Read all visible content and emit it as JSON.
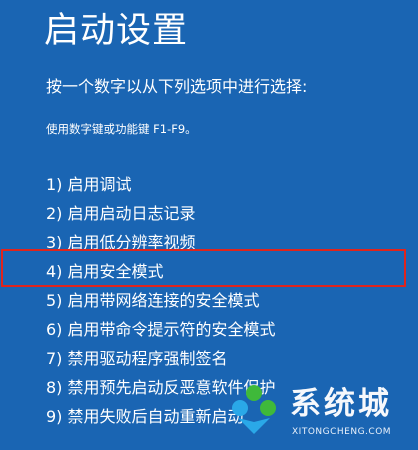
{
  "screen": {
    "title": "启动设置",
    "prompt": "按一个数字以从下列选项中进行选择:",
    "hint": "使用数字键或功能键 F1-F9。",
    "options": [
      {
        "label": "1) 启用调试"
      },
      {
        "label": "2) 启用启动日志记录"
      },
      {
        "label": "3) 启用低分辨率视频"
      },
      {
        "label": "4) 启用安全模式"
      },
      {
        "label": "5) 启用带网络连接的安全模式"
      },
      {
        "label": "6) 启用带命令提示符的安全模式"
      },
      {
        "label": "7) 禁用驱动程序强制签名"
      },
      {
        "label": "8) 禁用预先启动反恶意软件保护"
      },
      {
        "label": "9) 禁用失败后自动重新启动"
      }
    ],
    "highlighted_option_index": 3
  },
  "watermark": {
    "text": "系统城",
    "url_text": "XITONGCHENG.COM"
  },
  "colors": {
    "background": "#1a65b3",
    "text": "#ffffff",
    "highlight_border": "#e0241c",
    "logo_green": "#3fb93a",
    "logo_blue": "#2aa8e8"
  }
}
